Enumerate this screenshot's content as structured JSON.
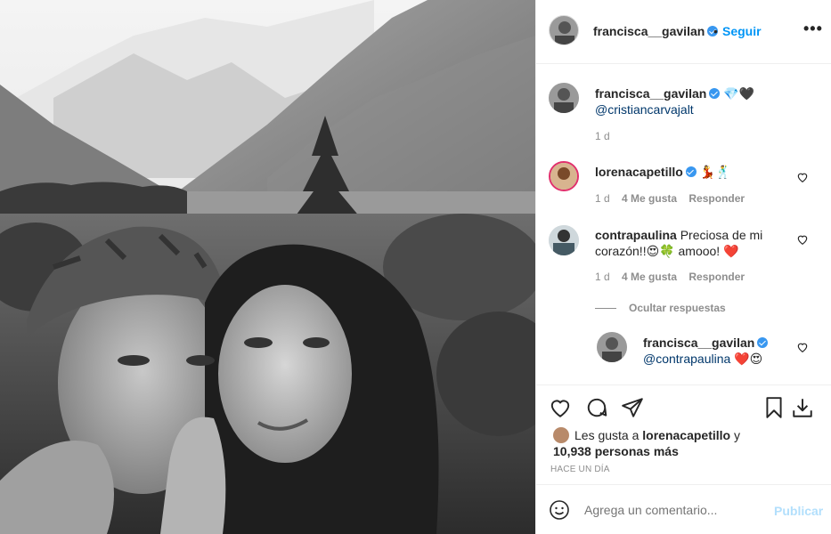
{
  "post": {
    "author": "francisca__gavilan",
    "follow_label": "Seguir",
    "more_label": "•••",
    "dot": "•"
  },
  "caption": {
    "username": "francisca__gavilan",
    "text": "💎🖤",
    "mention": "@cristiancarvajalt",
    "time": "1 d"
  },
  "comments": [
    {
      "username": "lorenacapetillo",
      "text": "💃🕺",
      "time": "1 d",
      "likes": "4 Me gusta",
      "reply_label": "Responder"
    },
    {
      "username": "contrapaulina",
      "text_line1": "Preciosa de mi",
      "text_line2": "corazón!!😍🍀 amooo! ❤️",
      "time": "1 d",
      "likes": "4 Me gusta",
      "reply_label": "Responder"
    }
  ],
  "hide_replies_label": "Ocultar respuestas",
  "reply": {
    "username": "francisca__gavilan",
    "mention": "@contrapaulina",
    "text": "❤️😍"
  },
  "likes_summary": {
    "prefix": "Les gusta a",
    "user": "lorenacapetillo",
    "joiner": "y",
    "others": "10,938 personas más"
  },
  "timestamp": "HACE UN DÍA",
  "composer": {
    "placeholder": "Agrega un comentario...",
    "post_label": "Publicar"
  },
  "icons": {
    "like": "heart-icon",
    "comment": "comment-icon",
    "share": "paper-plane-icon",
    "save": "bookmark-icon",
    "download": "download-icon",
    "emoji": "smiley-icon",
    "more": "more-options-icon",
    "verified": "verified-badge-icon"
  },
  "colors": {
    "link_blue": "#0095f6",
    "verified_blue": "#3897f0",
    "muted_gray": "#8e8e8e",
    "post_disabled": "#b2dffc",
    "border": "#efefef"
  }
}
